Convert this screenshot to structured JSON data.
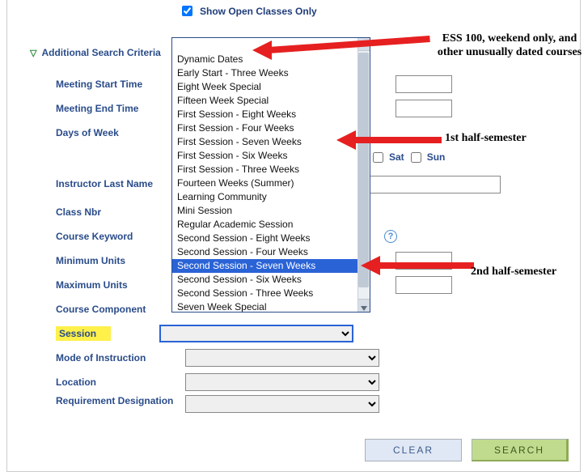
{
  "top_checkbox": {
    "label": "Show Open Classes Only",
    "checked": true
  },
  "section_header": "Additional Search Criteria",
  "labels": {
    "meeting_start": "Meeting Start Time",
    "meeting_end": "Meeting End Time",
    "days_of_week": "Days of Week",
    "instructor": "Instructor Last Name",
    "class_nbr": "Class Nbr",
    "course_keyword": "Course Keyword",
    "min_units": "Minimum Units",
    "max_units": "Maximum Units",
    "course_component": "Course Component",
    "session": "Session",
    "mode": "Mode of Instruction",
    "location": "Location",
    "req_desig": "Requirement Designation"
  },
  "days": [
    "Sat",
    "Sun"
  ],
  "dropdown_items": [
    "",
    "Dynamic Dates",
    "Early Start - Three Weeks",
    "Eight Week Special",
    "Fifteen Week Special",
    "First Session - Eight Weeks",
    "First Session - Four Weeks",
    "First Session - Seven Weeks",
    "First Session - Six Weeks",
    "First Session - Three Weeks",
    "Fourteen Weeks (Summer)",
    "Learning Community",
    "Mini Session",
    "Regular Academic Session",
    "Second Session - Eight Weeks",
    "Second Session - Four Weeks",
    "Second Session - Seven Weeks",
    "Second Session - Six Weeks",
    "Second Session - Three Weeks",
    "Seven Week Special"
  ],
  "dropdown_selected_index": 16,
  "annotations": {
    "a1": "ESS 100, weekend only, and other unusually dated courses",
    "a2": "1st half-semester",
    "a3": "2nd half-semester"
  },
  "buttons": {
    "clear": "Clear",
    "search": "Search"
  }
}
